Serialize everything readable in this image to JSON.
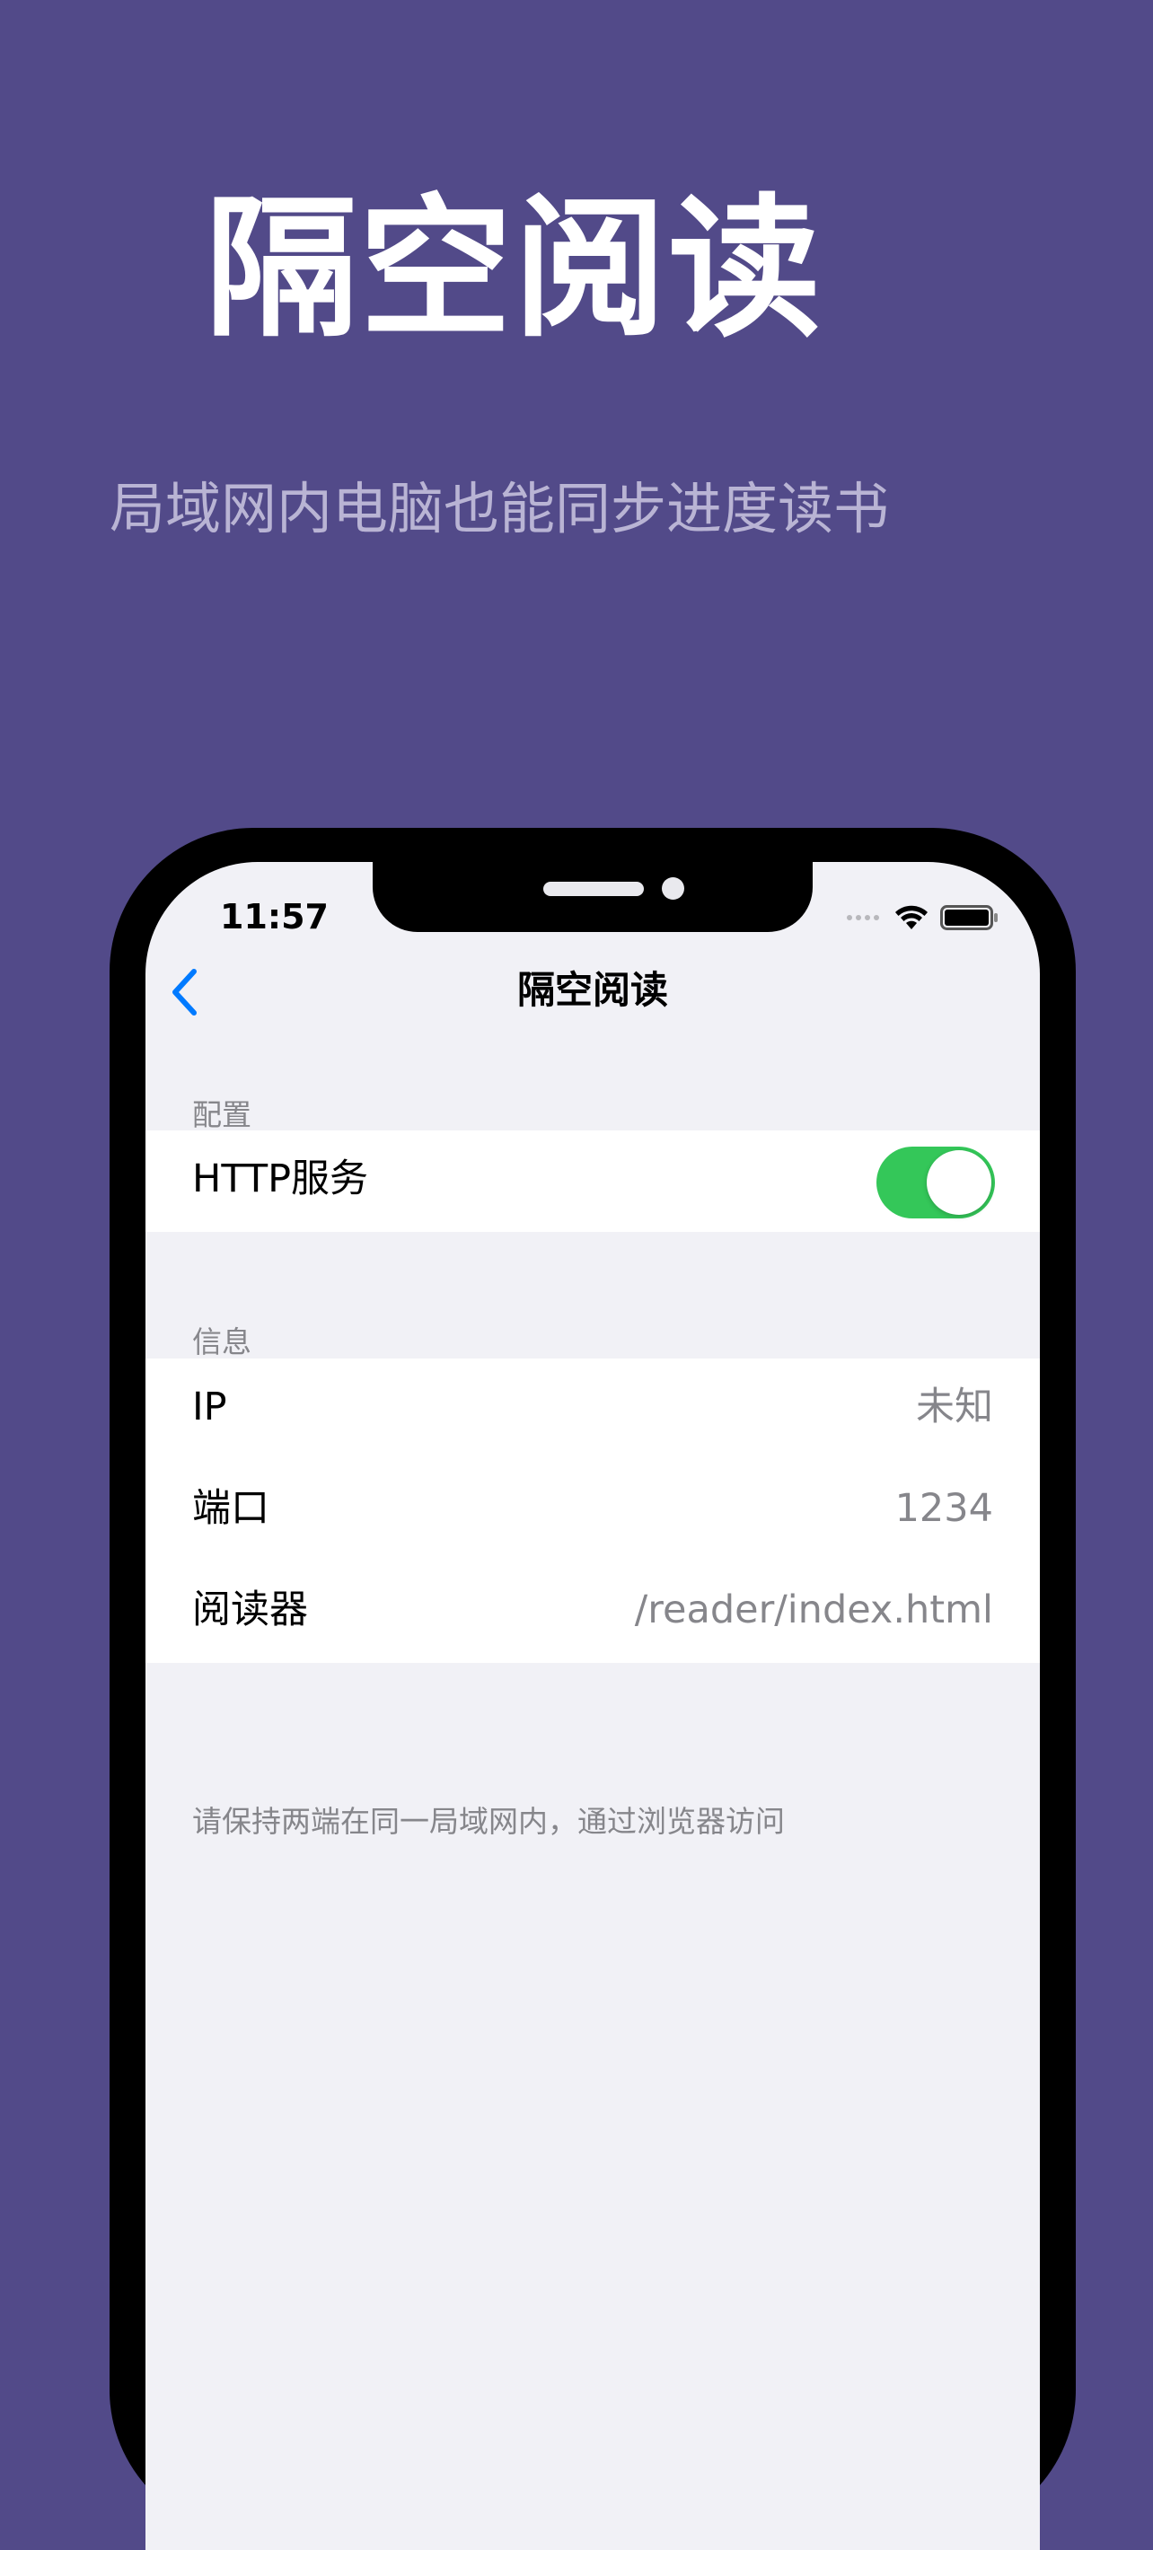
{
  "hero": {
    "title": "隔空阅读",
    "subtitle": "局域网内电脑也能同步进度读书"
  },
  "status_bar": {
    "time": "11:57",
    "icons": [
      "signal-icon",
      "wifi-icon",
      "battery-icon"
    ]
  },
  "nav": {
    "back_icon": "chevron-left-icon",
    "title": "隔空阅读"
  },
  "sections": {
    "config": {
      "header": "配置",
      "rows": [
        {
          "label": "HTTP服务",
          "toggle_on": true
        }
      ]
    },
    "info": {
      "header": "信息",
      "rows": [
        {
          "label": "IP",
          "value": "未知"
        },
        {
          "label": "端口",
          "value": "1234"
        },
        {
          "label": "阅读器",
          "value": "/reader/index.html"
        }
      ]
    }
  },
  "footer_note": "请保持两端在同一局域网内，通过浏览器访问",
  "colors": {
    "background": "#524a89",
    "accent": "#007aff",
    "toggle_on": "#34c759"
  }
}
